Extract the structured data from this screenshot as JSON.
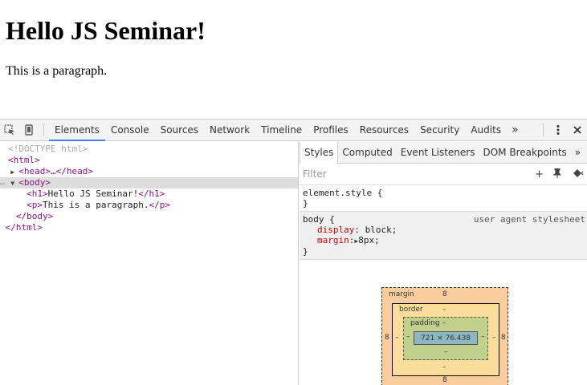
{
  "page": {
    "heading": "Hello JS Seminar!",
    "paragraph": "This is a paragraph."
  },
  "devtools": {
    "tabs": [
      "Elements",
      "Console",
      "Sources",
      "Network",
      "Timeline",
      "Profiles",
      "Resources",
      "Security",
      "Audits"
    ],
    "active_tab": "Elements",
    "more": "»",
    "elements_tree": {
      "doctype": "<!DOCTYPE html>",
      "html_open": "<html>",
      "head": "<head>…</head>",
      "body_open": "<body>",
      "h1_open": "<h1>",
      "h1_text": "Hello JS Seminar!",
      "h1_close": "</h1>",
      "p_open": "<p>",
      "p_text": "This is a paragraph.",
      "p_close": "</p>",
      "body_close": "</body>",
      "html_close": "</html>",
      "dots": "…"
    },
    "styles_tabs": [
      "Styles",
      "Computed",
      "Event Listeners",
      "DOM Breakpoints"
    ],
    "styles_more": "»",
    "filter_placeholder": "Filter",
    "filter_icons": {
      "add": "+",
      "pin": "📌",
      "toggle": "◆"
    },
    "element_style": {
      "selector": "element.style {",
      "close": "}"
    },
    "body_rule": {
      "selector": "body {",
      "source": "user agent stylesheet",
      "props": [
        {
          "name": "display",
          "value": "block;"
        },
        {
          "name": "margin",
          "value": "8px;"
        }
      ],
      "close": "}"
    },
    "box_model": {
      "margin_label": "margin",
      "margin_top": "8",
      "margin_bottom": "8",
      "margin_left": "8",
      "margin_right": "8",
      "border_label": "border",
      "border_top": "–",
      "border_bottom": "–",
      "border_left": "–",
      "border_right": "–",
      "padding_label": "padding",
      "padding_top": "–",
      "padding_bottom": "–",
      "padding_left": "–",
      "padding_right": "–",
      "content": "721 × 76.438"
    }
  }
}
